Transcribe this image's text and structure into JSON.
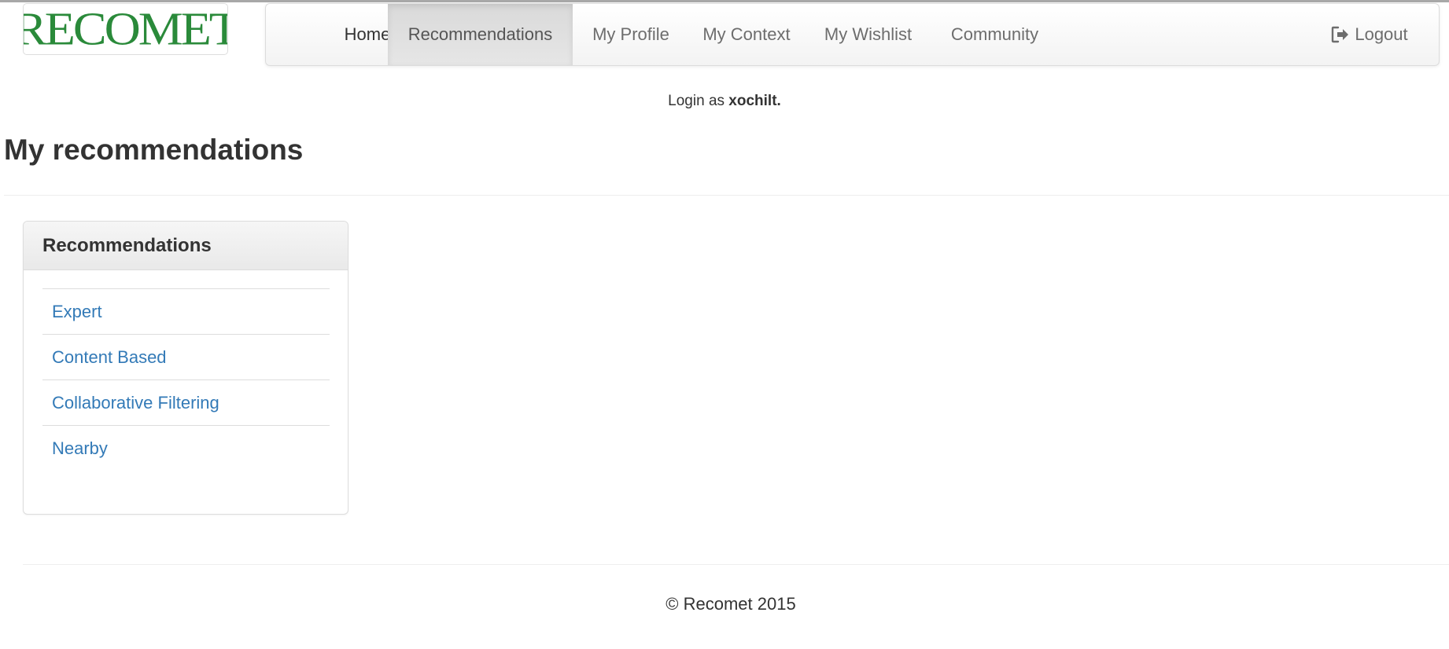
{
  "brand": {
    "logo_text": "RECOMET",
    "logo_color": "#2a8a3a"
  },
  "nav": {
    "items": [
      {
        "label": "Home"
      },
      {
        "label": "Recommendations",
        "active": true
      },
      {
        "label": "My Profile"
      },
      {
        "label": "My Context"
      },
      {
        "label": "My Wishlist"
      },
      {
        "label": "Community"
      }
    ],
    "logout": {
      "label": "Logout",
      "icon": "logout-icon"
    }
  },
  "session": {
    "prefix": "Login as",
    "username": "xochilt."
  },
  "page": {
    "title": "My recommendations"
  },
  "panel": {
    "heading": "Recommendations",
    "links": [
      {
        "label": "Expert"
      },
      {
        "label": "Content Based"
      },
      {
        "label": "Collaborative Filtering"
      },
      {
        "label": "Nearby"
      }
    ],
    "link_color": "#337ab7"
  },
  "footer": {
    "text": "© Recomet 2015"
  }
}
